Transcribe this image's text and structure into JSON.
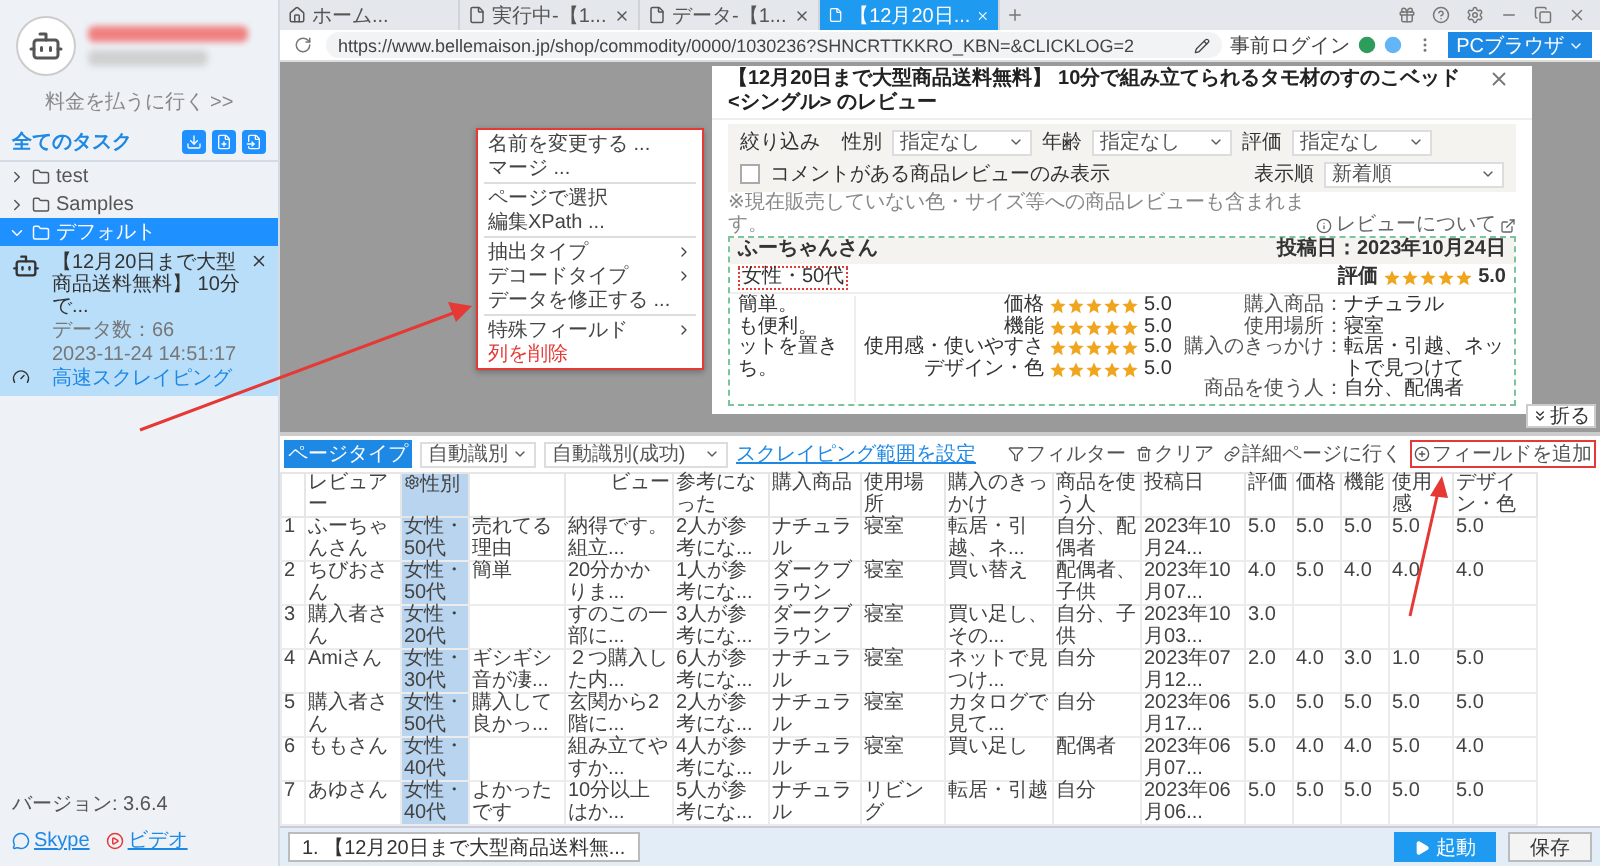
{
  "sidebar": {
    "upgrade_link": "料金を払うに行く >>",
    "section_title": "全てのタスク",
    "folders": [
      {
        "label": "test",
        "expanded": false,
        "selected": false
      },
      {
        "label": "Samples",
        "expanded": false,
        "selected": false
      },
      {
        "label": "デフォルト",
        "expanded": true,
        "selected": true,
        "tasks": [
          {
            "title": "【12月20日まで大型商品送料無料】 10分で...",
            "data_count": "データ数：66",
            "time": "2023-11-24 14:51:17",
            "mode": "高速スクレイピング"
          }
        ]
      }
    ],
    "links": [
      {
        "label": "Skype",
        "kind": "chat"
      },
      {
        "label": "ビデオ",
        "kind": "video"
      }
    ],
    "version": "バージョン: 3.6.4"
  },
  "browser": {
    "tabs": [
      {
        "label": "ホーム...",
        "kind": "home",
        "selected": false
      },
      {
        "label": "実行中-【1...",
        "kind": "page",
        "selected": false
      },
      {
        "label": "データ-【1...",
        "kind": "page",
        "selected": false
      },
      {
        "label": "【12月20日...",
        "kind": "page",
        "selected": true
      }
    ],
    "url": "https://www.bellemaison.jp/shop/commodity/0000/1030236?SHNCRTTKKRO_KBN=&CLICKLOG=2",
    "login": "事前ログイン",
    "mode_button": "PCブラウザ"
  },
  "modal": {
    "title": "【12月20日まで大型商品送料無料】 10分で組み立てられるタモ材のすのこベッド <シングル> のレビュー",
    "filters": {
      "label": "絞り込み",
      "selects": [
        {
          "label": "性別",
          "value": "指定なし"
        },
        {
          "label": "年齢",
          "value": "指定なし"
        },
        {
          "label": "評価",
          "value": "指定なし"
        }
      ],
      "checkbox": {
        "label": "コメントがある商品レビューのみ表示",
        "checked": false
      },
      "sort": {
        "label": "表示順",
        "value": "新着順"
      }
    },
    "note": "※現在販売していない色・サイズ等への商品レビューも含まれます。",
    "about_link": "レビューについて",
    "review": {
      "reviewer": "ふーちゃんさん",
      "date": "投稿日：2023年10月24日",
      "profile": "女性・50代",
      "rating_label": "評価",
      "stars": 5,
      "score": "5.0",
      "body": [
        "簡単。",
        "も便利。",
        "ットを置き",
        "ち。"
      ],
      "ratings": [
        {
          "label": "価格",
          "stars": 5,
          "score": "5.0"
        },
        {
          "label": "機能",
          "stars": 5,
          "score": "5.0"
        },
        {
          "label": "使用感・使いやすさ",
          "stars": 5,
          "score": "5.0"
        },
        {
          "label": "デザイン・色",
          "stars": 5,
          "score": "5.0"
        }
      ],
      "details": [
        {
          "label": "購入商品：",
          "value": "ナチュラル"
        },
        {
          "label": "使用場所：",
          "value": "寝室"
        },
        {
          "label": "購入のきっかけ：",
          "value": "転居・引越、ネットで見つけて"
        },
        {
          "label": "商品を使う人：",
          "value": "自分、配偶者"
        }
      ]
    }
  },
  "context_menu": {
    "groups": [
      [
        {
          "label": "名前を変更する ...",
          "submenu": false,
          "danger": false
        },
        {
          "label": "マージ ...",
          "submenu": false,
          "danger": false
        }
      ],
      [
        {
          "label": "ページで選択",
          "submenu": false,
          "danger": false
        },
        {
          "label": "編集XPath ...",
          "submenu": false,
          "danger": false
        }
      ],
      [
        {
          "label": "抽出タイプ",
          "submenu": true,
          "danger": false
        },
        {
          "label": "デコードタイプ",
          "submenu": true,
          "danger": false
        },
        {
          "label": "データを修正する ...",
          "submenu": false,
          "danger": false
        }
      ],
      [
        {
          "label": "特殊フィールド",
          "submenu": true,
          "danger": false
        },
        {
          "label": "列を削除",
          "submenu": false,
          "danger": true
        }
      ]
    ]
  },
  "data_panel": {
    "collapse": "折る",
    "page_type": "ページタイプ",
    "page_mode": "自動識別",
    "status": "自動識別(成功)",
    "range_link": "スクレイピング範囲を設定",
    "actions": [
      {
        "label": "フィルター",
        "kind": "filter",
        "highlighted": false
      },
      {
        "label": "クリア",
        "kind": "clear",
        "highlighted": false
      },
      {
        "label": "詳細ページに行く",
        "kind": "link",
        "highlighted": false
      },
      {
        "label": "フィールドを追加",
        "kind": "add",
        "highlighted": true
      }
    ],
    "columns": [
      {
        "selected": false
      },
      {
        "label": "レビュアー",
        "selected": false
      },
      {
        "label": "性別",
        "selected": true
      },
      {
        "selected": false
      },
      {
        "label": "ビュー",
        "selected": false
      },
      {
        "label": "参考になった",
        "selected": false
      },
      {
        "label": "購入商品",
        "selected": false
      },
      {
        "label": "使用場所",
        "selected": false
      },
      {
        "label": "購入のきっかけ",
        "selected": false
      },
      {
        "label": "商品を使う人",
        "selected": false
      },
      {
        "label": "投稿日",
        "selected": false
      },
      {
        "label": "評価",
        "selected": false
      },
      {
        "label": "価格",
        "selected": false
      },
      {
        "label": "機能",
        "selected": false
      },
      {
        "label": "使用感",
        "selected": false
      },
      {
        "label": "デザイン・色",
        "selected": false
      }
    ],
    "rows": [
      [
        "1",
        "ふーちゃんさん",
        "女性・50代",
        "売れてる理由",
        "納得です。組立...",
        "2人が参考にな...",
        "ナチュラル",
        "寝室",
        "転居・引越、ネ...",
        "自分、配偶者",
        "2023年10月24...",
        "5.0",
        "5.0",
        "5.0",
        "5.0",
        "5.0"
      ],
      [
        "2",
        "ちびおさん",
        "女性・50代",
        "簡単",
        "20分かかりま...",
        "1人が参考にな...",
        "ダークブラウン",
        "寝室",
        "買い替え",
        "配偶者、子供",
        "2023年10月07...",
        "4.0",
        "5.0",
        "4.0",
        "4.0",
        "4.0"
      ],
      [
        "3",
        "購入者さん",
        "女性・20代",
        null,
        "すのこの一部に...",
        "3人が参考にな...",
        "ダークブラウン",
        "寝室",
        "買い足し、その...",
        "自分、子供",
        "2023年10月03...",
        "3.0",
        null,
        null,
        null,
        null
      ],
      [
        "4",
        "Amiさん",
        "女性・30代",
        "ギシギシ音が凄...",
        "２つ購入した内...",
        "6人が参考にな...",
        "ナチュラル",
        "寝室",
        "ネットで見つけ...",
        "自分",
        "2023年07月12...",
        "2.0",
        "4.0",
        "3.0",
        "1.0",
        "5.0"
      ],
      [
        "5",
        "購入者さん",
        "女性・50代",
        "購入して良かっ...",
        "玄関から2階に...",
        "2人が参考にな...",
        "ナチュラル",
        "寝室",
        "カタログで見て...",
        "自分",
        "2023年06月17...",
        "5.0",
        "5.0",
        "5.0",
        "5.0",
        "5.0"
      ],
      [
        "6",
        "ももさん",
        "女性・40代",
        null,
        "組み立てやすか...",
        "4人が参考にな...",
        "ナチュラル",
        "寝室",
        "買い足し",
        "配偶者",
        "2023年06月07...",
        "5.0",
        "4.0",
        "4.0",
        "5.0",
        "4.0"
      ],
      [
        "7",
        "あゆさん",
        "女性・40代",
        "よかったです",
        "10分以上はか...",
        "5人が参考にな...",
        "ナチュラル",
        "リビング",
        "転居・引越",
        "自分",
        "2023年06月06...",
        "5.0",
        "5.0",
        "5.0",
        "5.0",
        "5.0"
      ]
    ]
  },
  "footer": {
    "task_tab": "1. 【12月20日まで大型商品送料無...",
    "start": "起動",
    "save": "保存"
  }
}
